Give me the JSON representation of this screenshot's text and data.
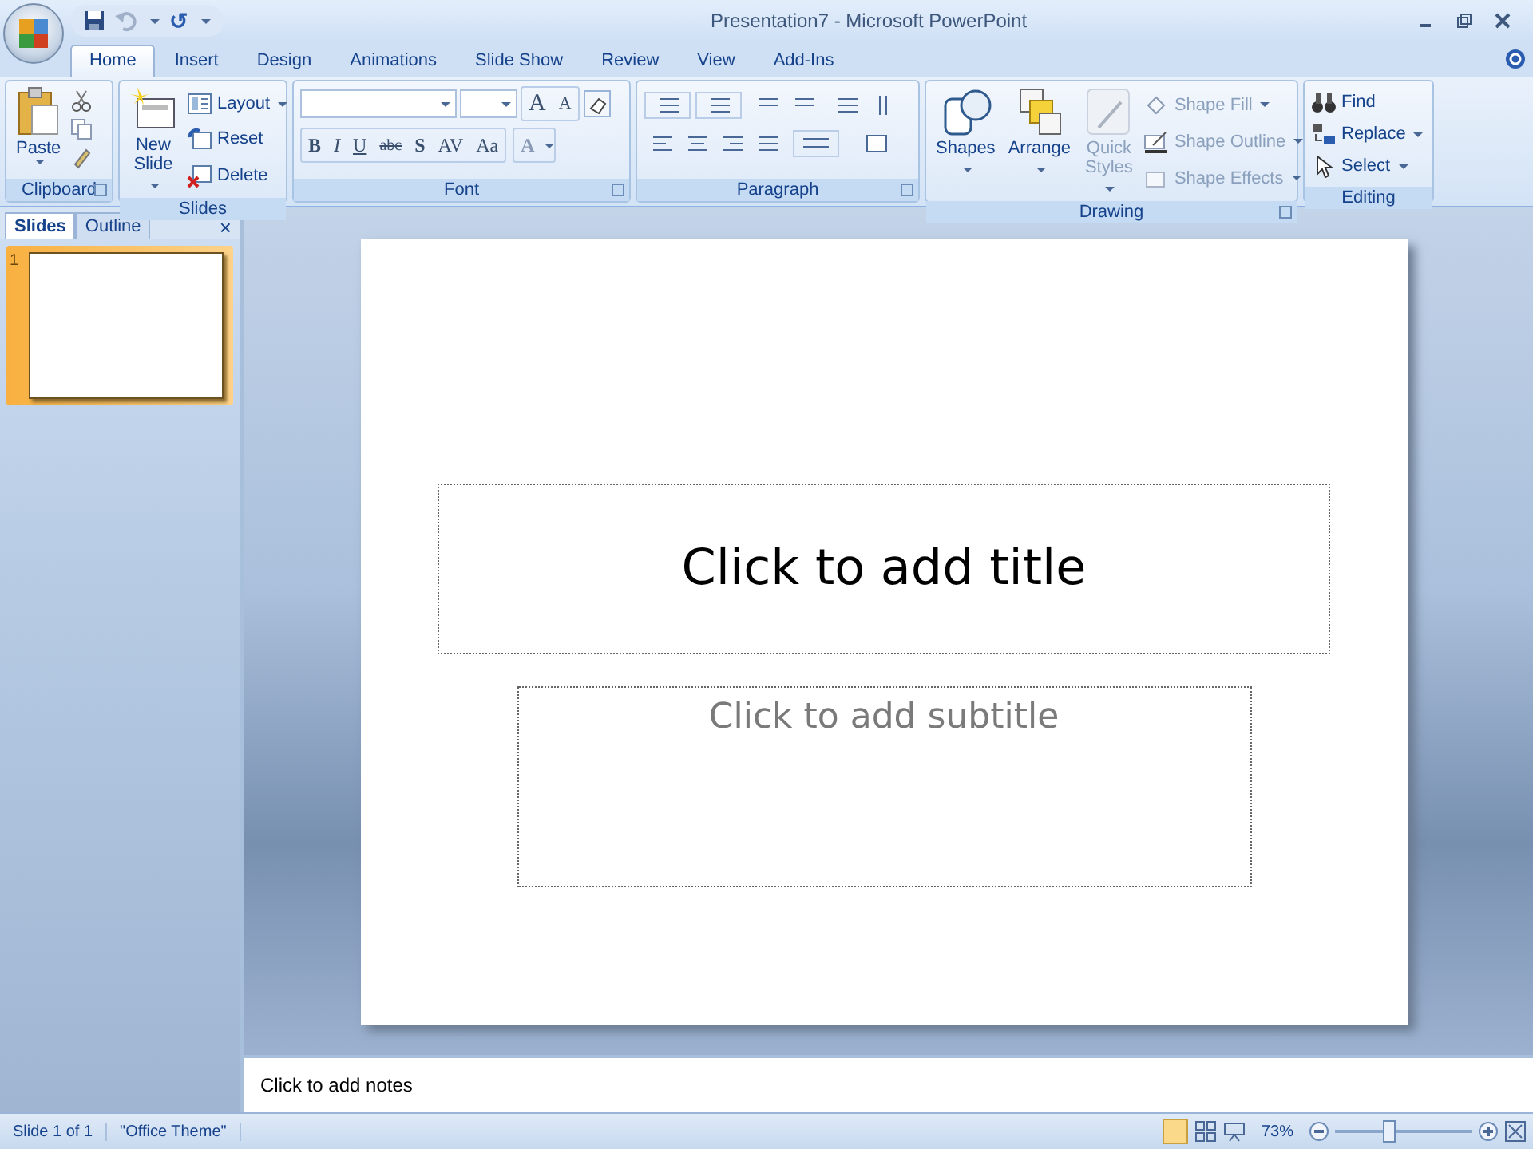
{
  "window": {
    "title": "Presentation7 - Microsoft PowerPoint"
  },
  "quick_access": {
    "redo_label": "↺"
  },
  "tabs": [
    {
      "label": "Home",
      "selected": true
    },
    {
      "label": "Insert",
      "selected": false
    },
    {
      "label": "Design",
      "selected": false
    },
    {
      "label": "Animations",
      "selected": false
    },
    {
      "label": "Slide Show",
      "selected": false
    },
    {
      "label": "Review",
      "selected": false
    },
    {
      "label": "View",
      "selected": false
    },
    {
      "label": "Add-Ins",
      "selected": false
    }
  ],
  "groups": {
    "clipboard": {
      "label": "Clipboard",
      "paste": "Paste"
    },
    "slides": {
      "label": "Slides",
      "new_slide": [
        "New",
        "Slide"
      ],
      "commands": [
        {
          "kind": "layout",
          "label": "Layout",
          "menu": true
        },
        {
          "kind": "reset",
          "label": "Reset",
          "menu": false
        },
        {
          "kind": "delete",
          "label": "Delete",
          "menu": false
        }
      ]
    },
    "font": {
      "label": "Font",
      "size_buttons": [
        "A",
        "A"
      ],
      "format_buttons": [
        {
          "label": "B",
          "kind": "bold"
        },
        {
          "label": "I",
          "kind": "italic"
        },
        {
          "label": "U",
          "kind": "underline"
        },
        {
          "label": "abc",
          "kind": "strike"
        },
        {
          "label": "S",
          "kind": "shadow"
        },
        {
          "label": "AV",
          "kind": "spacing"
        },
        {
          "label": "Aa",
          "kind": "case"
        }
      ],
      "color_button": "A"
    },
    "paragraph": {
      "label": "Paragraph"
    },
    "drawing": {
      "label": "Drawing",
      "big": [
        {
          "kind": "shapes",
          "label": [
            "Shapes"
          ],
          "disabled": false
        },
        {
          "kind": "arrange",
          "label": [
            "Arrange"
          ],
          "disabled": false
        },
        {
          "kind": "styles",
          "label": [
            "Quick",
            "Styles"
          ],
          "disabled": true
        }
      ],
      "commands": [
        {
          "kind": "fill",
          "label": "Shape Fill",
          "disabled": true
        },
        {
          "kind": "outline",
          "label": "Shape Outline",
          "disabled": true
        },
        {
          "kind": "effects",
          "label": "Shape Effects",
          "disabled": true
        }
      ]
    },
    "editing": {
      "label": "Editing",
      "commands": [
        {
          "kind": "find",
          "label": "Find",
          "menu": false
        },
        {
          "kind": "replace",
          "label": "Replace",
          "menu": true
        },
        {
          "kind": "select",
          "label": "Select",
          "menu": true
        }
      ]
    }
  },
  "pane_tabs": [
    {
      "label": "Slides",
      "selected": true
    },
    {
      "label": "Outline",
      "selected": false
    }
  ],
  "pane_close": "×",
  "thumbnails": [
    {
      "number": "1",
      "selected": true
    }
  ],
  "slide": {
    "title_placeholder": "Click to add title",
    "subtitle_placeholder": "Click to add subtitle"
  },
  "notes": {
    "placeholder": "Click to add notes"
  },
  "status_bar": {
    "slide": "Slide 1 of 1",
    "theme": "\"Office Theme\"",
    "zoom": {
      "reading": "73%",
      "level": 0.4
    }
  }
}
